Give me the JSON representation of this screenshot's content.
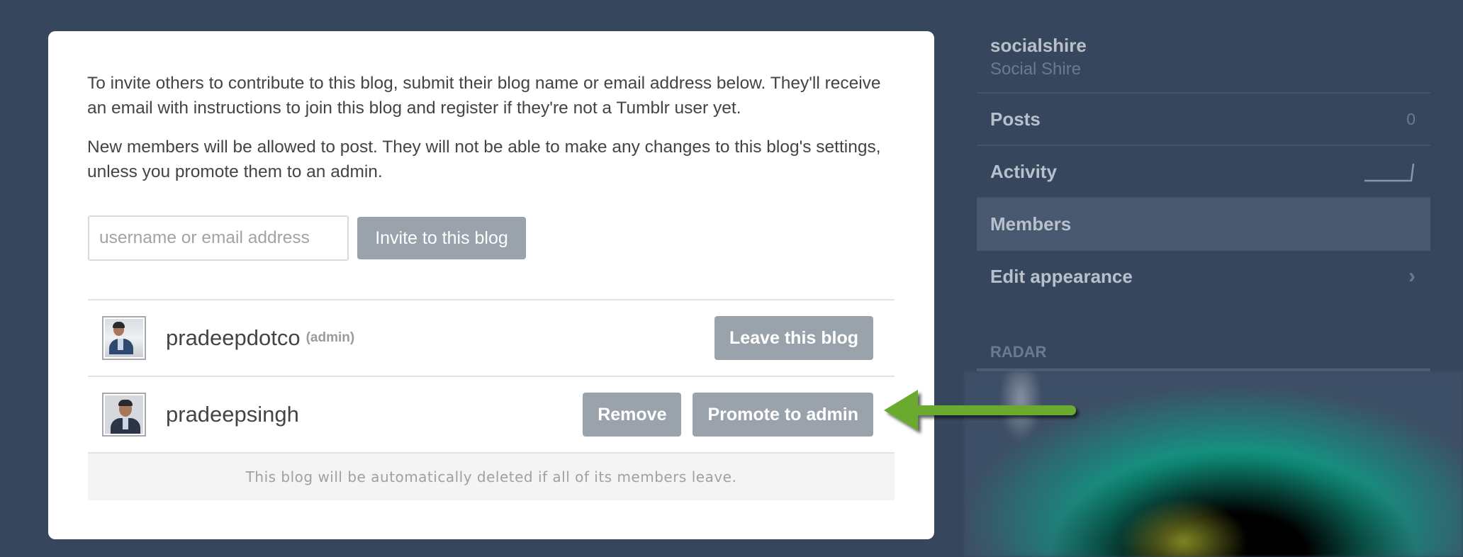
{
  "modal": {
    "intro_paragraphs": [
      "To invite others to contribute to this blog, submit their blog name or email address below. They'll receive an email with instructions to join this blog and register if they're not a Tumblr user yet.",
      "New members will be allowed to post. They will not be able to make any changes to this blog's settings, unless you promote them to an admin."
    ],
    "invite": {
      "placeholder": "username or email address",
      "value": "",
      "button_label": "Invite to this blog"
    },
    "members": [
      {
        "username": "pradeepdotco",
        "role_tag": "(admin)",
        "actions": [
          {
            "label": "Leave this blog",
            "name": "leave-blog-button"
          }
        ]
      },
      {
        "username": "pradeepsingh",
        "role_tag": "",
        "actions": [
          {
            "label": "Remove",
            "name": "remove-member-button"
          },
          {
            "label": "Promote to admin",
            "name": "promote-to-admin-button"
          }
        ]
      }
    ],
    "notice": "This blog will be automatically deleted if all of its members leave."
  },
  "sidebar": {
    "blog_name": "socialshire",
    "blog_title": "Social Shire",
    "nav": [
      {
        "label": "Posts",
        "count": "0",
        "icon": ""
      },
      {
        "label": "Activity",
        "count": "",
        "icon": "activity-sparkline-icon"
      },
      {
        "label": "Members",
        "count": "",
        "icon": "",
        "active": true
      },
      {
        "label": "Edit appearance",
        "count": "",
        "icon": "chevron-right-icon"
      }
    ],
    "chevron_glyph": "›",
    "radar_label": "RADAR"
  },
  "annotation": {
    "arrow_color": "#6aaa2e",
    "arrow_target": "Promote to admin"
  },
  "colors": {
    "background": "#36465d",
    "button": "#9aa2ab",
    "sidebar_active": "#48586f"
  }
}
